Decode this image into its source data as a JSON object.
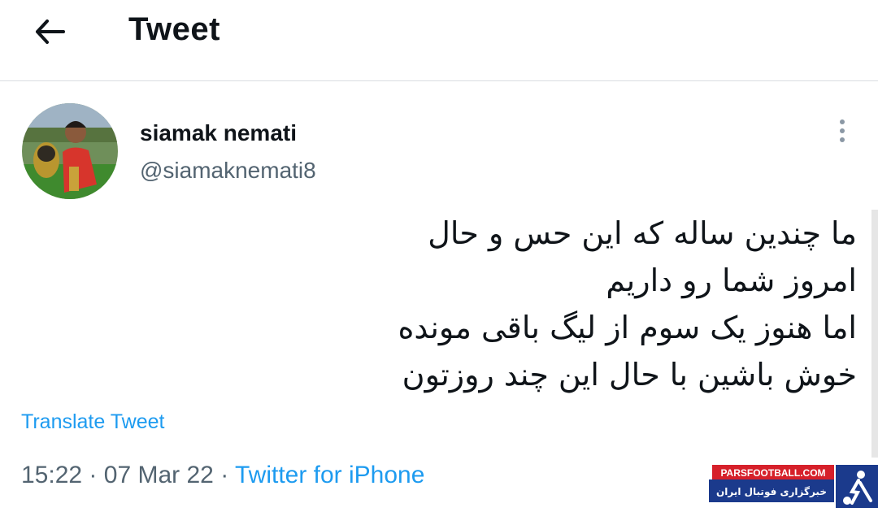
{
  "header": {
    "title": "Tweet",
    "back_icon": "arrow-left-icon"
  },
  "tweet": {
    "author": {
      "display_name": "siamak nemati",
      "handle": "@siamaknemati8"
    },
    "more_icon": "vertical-dots-icon",
    "text_lines": [
      "ما چندین ساله که این حس و حال",
      "امروز شما رو داریم",
      "اما هنوز یک سوم از لیگ باقی مونده",
      "خوش باشین با حال این چند روزتون"
    ],
    "translate_label": "Translate Tweet",
    "time": "15:22",
    "separator": "·",
    "date": "07 Mar 22",
    "source": "Twitter for iPhone"
  },
  "watermark": {
    "site": "PARSFOOTBALL.COM",
    "tagline": "خبرگزاری فوتبال ایران"
  },
  "colors": {
    "link": "#1d9bf0",
    "secondary_text": "#536471",
    "watermark_red": "#d6202a",
    "watermark_blue": "#1b3a8c"
  }
}
